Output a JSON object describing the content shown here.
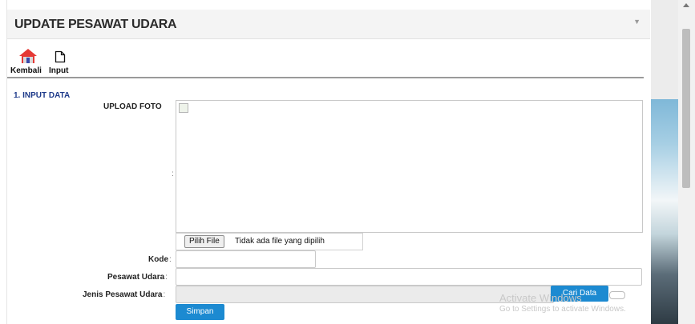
{
  "panel": {
    "title": "UPDATE PESAWAT UDARA",
    "toggle_icon": "chevron-down-icon"
  },
  "toolbar": {
    "back_label": "Kembali",
    "back_icon": "home-icon",
    "input_label": "Input",
    "input_icon": "document-icon"
  },
  "section": {
    "title": "1. INPUT DATA"
  },
  "form": {
    "upload_label": "UPLOAD FOTO",
    "file_button": "Pilih File",
    "file_status": "Tidak ada file yang dipilih",
    "kode_label": "Kode",
    "kode_value": "",
    "pesawat_label": "Pesawat Udara",
    "pesawat_value": "",
    "jenis_label": "Jenis Pesawat Udara",
    "jenis_value": "",
    "colon": ":",
    "search_button": "Cari Data",
    "submit_button": "Simpan"
  },
  "watermark": {
    "line1": "Activate Windows",
    "line2": "Go to Settings to activate Windows."
  },
  "colors": {
    "accent": "#1c8ad1",
    "section_title": "#1e3a8a",
    "home_icon": "#e53935"
  }
}
